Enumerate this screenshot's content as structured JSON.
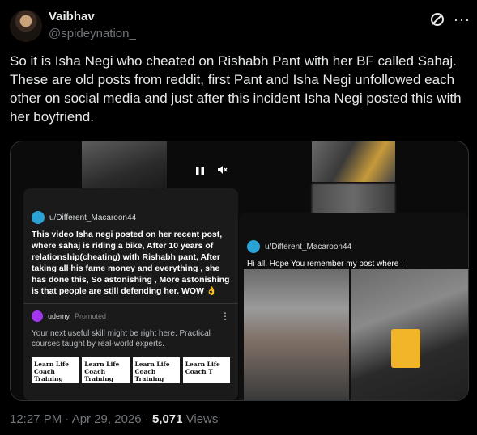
{
  "author": {
    "name": "Vaibhav",
    "handle": "@spideynation_"
  },
  "tweet": {
    "text": "So it is Isha Negi who cheated on Rishabh Pant with her BF called Sahaj. These are old posts from reddit, first Pant and Isha Negi unfollowed each other on social media and just after this incident Isha Negi posted this with her boyfriend."
  },
  "media": {
    "left_post": {
      "user": "u/Different_Macaroon44",
      "body": "This video Isha negi posted on her recent post, where sahaj is riding a bike, After 10 years of relationship(cheating) with Rishabh pant, After taking all his fame money and everything , she has done this, So astonishing , More astonishing is that people are still defending her. WOW 👌",
      "ad": {
        "name": "udemy",
        "promoted": "Promoted",
        "text": "Your next useful skill might be right here. Practical courses taught by real-world experts.",
        "courses": [
          "Learn Life Coach Training",
          "Learn Life Coach Training",
          "Learn Life Coach Training",
          "Learn Life Coach T"
        ]
      }
    },
    "right_post": {
      "user": "u/Different_Macaroon44",
      "body": "Hi all, Hope You remember my post where I"
    }
  },
  "meta": {
    "time": "12:27 PM · Apr 29, 2026 · ",
    "views_count": "5,071",
    "views_label": " Views"
  }
}
